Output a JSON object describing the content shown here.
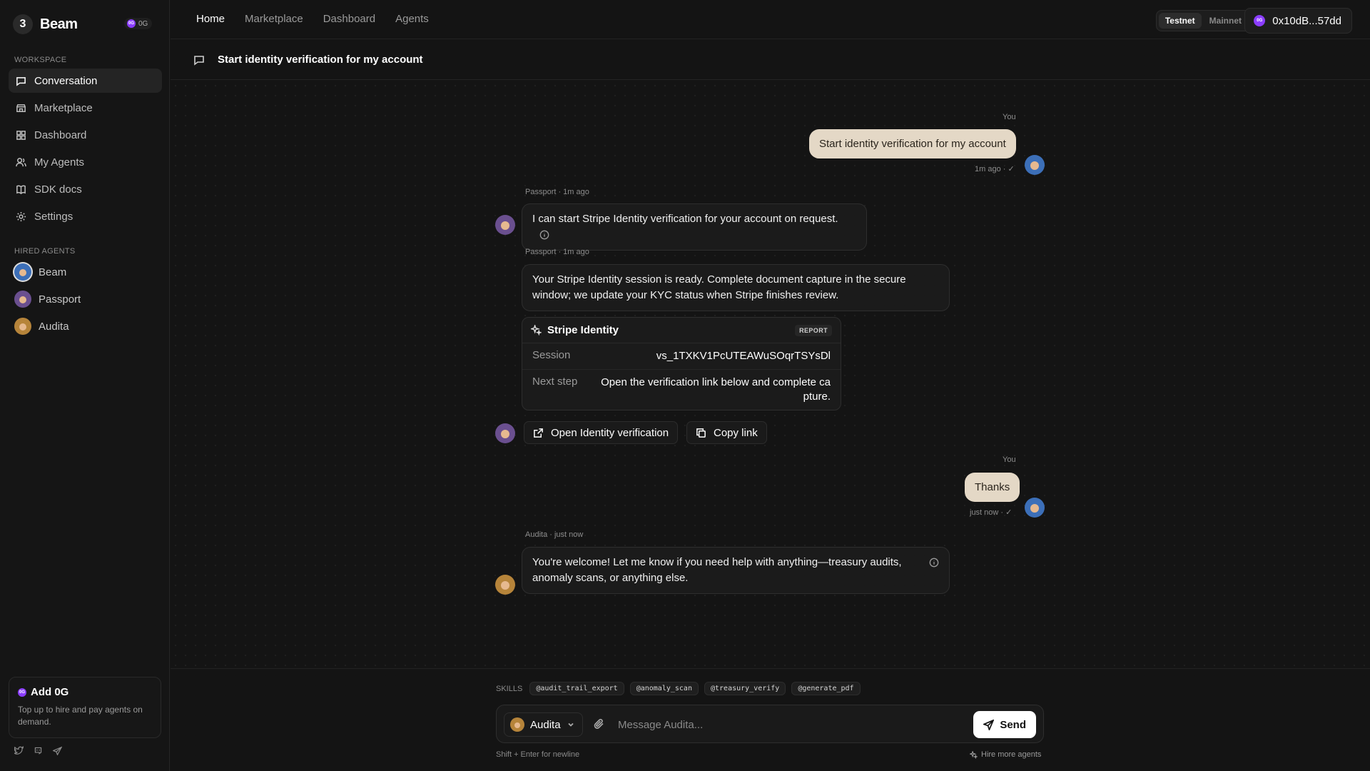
{
  "brand": {
    "name": "Beam",
    "logo_glyph": "3",
    "token_chip": "0G",
    "token_dot": "0G"
  },
  "sidebar": {
    "workspace_label": "WORKSPACE",
    "items": [
      {
        "label": "Conversation",
        "icon": "chat-icon"
      },
      {
        "label": "Marketplace",
        "icon": "store-icon"
      },
      {
        "label": "Dashboard",
        "icon": "grid-icon"
      },
      {
        "label": "My Agents",
        "icon": "users-icon"
      },
      {
        "label": "SDK docs",
        "icon": "book-icon"
      },
      {
        "label": "Settings",
        "icon": "gear-icon"
      }
    ],
    "hired_label": "HIRED AGENTS",
    "agents": [
      {
        "label": "Beam"
      },
      {
        "label": "Passport"
      },
      {
        "label": "Audita"
      }
    ],
    "add_card": {
      "title": "Add 0G",
      "desc": "Top up to hire and pay agents on demand."
    }
  },
  "topnav": {
    "items": [
      "Home",
      "Marketplace",
      "Dashboard",
      "Agents"
    ]
  },
  "network": {
    "testnet": "Testnet",
    "mainnet": "Mainnet"
  },
  "wallet": {
    "address": "0x10dB...57dd"
  },
  "conversation": {
    "title": "Start identity verification for my account"
  },
  "messages": {
    "m1": {
      "sender": "You",
      "text": "Start identity verification for my account",
      "meta": "1m ago ·"
    },
    "m2": {
      "meta": "Passport · 1m ago",
      "text": "I can start Stripe Identity verification for your account on request."
    },
    "m3": {
      "meta": "Passport · 1m ago",
      "text": "Your Stripe Identity session is ready. Complete document capture in the secure window; we update your KYC status when Stripe finishes review.",
      "card": {
        "title": "Stripe Identity",
        "badge": "REPORT",
        "session_key": "Session",
        "session_val": "vs_1TXKV1PcUTEAWuSOqrTSYsDl",
        "next_key": "Next step",
        "next_val": "Open the verification link below and complete capture."
      },
      "actions": {
        "open": "Open Identity verification",
        "copy": "Copy link"
      }
    },
    "m4": {
      "sender": "You",
      "text": "Thanks",
      "meta": "just now ·"
    },
    "m5": {
      "meta": "Audita · just now",
      "text": "You're welcome! Let me know if you need help with anything—treasury audits, anomaly scans, or anything else."
    }
  },
  "composer": {
    "skills_label": "SKILLS",
    "skills": [
      "@audit_trail_export",
      "@anomaly_scan",
      "@treasury_verify",
      "@generate_pdf"
    ],
    "agent": "Audita",
    "placeholder": "Message Audita...",
    "send": "Send",
    "hint": "Shift + Enter for newline",
    "hire": "Hire more agents"
  },
  "colors": {
    "accent_purple": "#8b3dff",
    "user_bubble": "#e4d8c6",
    "background": "#141414"
  }
}
